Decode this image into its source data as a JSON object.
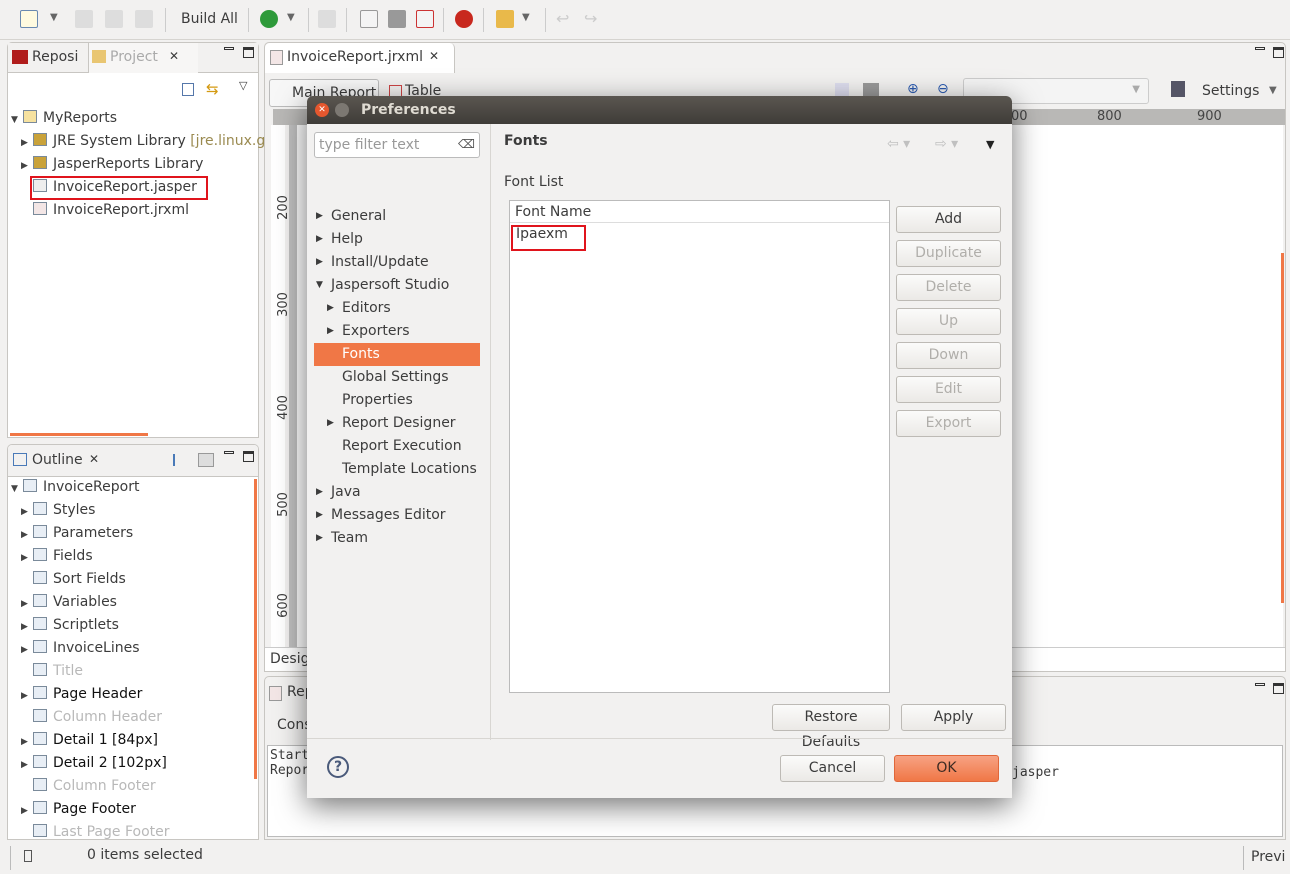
{
  "toolbar": {
    "build_all": "Build All"
  },
  "left_panel": {
    "tabs": [
      {
        "label": "Reposi"
      },
      {
        "label": "Project"
      }
    ],
    "tree": [
      {
        "label": "MyReports"
      },
      {
        "label": "JRE System Library",
        "suffix": "[jre.linux.gt"
      },
      {
        "label": "JasperReports Library"
      },
      {
        "label": "InvoiceReport.jasper"
      },
      {
        "label": "InvoiceReport.jrxml"
      }
    ]
  },
  "outline": {
    "title": "Outline",
    "items": [
      {
        "label": "InvoiceReport"
      },
      {
        "label": "Styles"
      },
      {
        "label": "Parameters"
      },
      {
        "label": "Fields"
      },
      {
        "label": "Sort Fields"
      },
      {
        "label": "Variables"
      },
      {
        "label": "Scriptlets"
      },
      {
        "label": "InvoiceLines"
      },
      {
        "label": "Title"
      },
      {
        "label": "Page Header"
      },
      {
        "label": "Column Header"
      },
      {
        "label": "Detail 1 [84px]"
      },
      {
        "label": "Detail 2 [102px]"
      },
      {
        "label": "Column Footer"
      },
      {
        "label": "Page Footer"
      },
      {
        "label": "Last Page Footer"
      }
    ]
  },
  "editor": {
    "tab": "InvoiceReport.jrxml",
    "subtabs": [
      {
        "label": "Main Report"
      },
      {
        "label": "Table"
      }
    ],
    "settings": "Settings",
    "ruler_top": [
      "00",
      "800",
      "900"
    ],
    "ruler_left": [
      "200",
      "300",
      "400",
      "500",
      "600"
    ],
    "design_tab": "Desig"
  },
  "console": {
    "tab": "Rep",
    "subtab": "Cons",
    "lines": [
      "Start",
      "Repor"
    ],
    "right_text": "jasper"
  },
  "status": {
    "text": "0 items selected",
    "right": "Previ"
  },
  "dialog": {
    "title": "Preferences",
    "filter_placeholder": "type filter text",
    "nav": [
      {
        "label": "General",
        "level": 0,
        "arrow": "right"
      },
      {
        "label": "Help",
        "level": 0,
        "arrow": "right"
      },
      {
        "label": "Install/Update",
        "level": 0,
        "arrow": "right"
      },
      {
        "label": "Jaspersoft Studio",
        "level": 0,
        "arrow": "down"
      },
      {
        "label": "Editors",
        "level": 1,
        "arrow": "right"
      },
      {
        "label": "Exporters",
        "level": 1,
        "arrow": "right"
      },
      {
        "label": "Fonts",
        "level": 1,
        "selected": true
      },
      {
        "label": "Global Settings",
        "level": 1
      },
      {
        "label": "Properties",
        "level": 1
      },
      {
        "label": "Report Designer",
        "level": 1,
        "arrow": "right"
      },
      {
        "label": "Report Execution",
        "level": 1
      },
      {
        "label": "Template Locations",
        "level": 1
      },
      {
        "label": "Java",
        "level": 0,
        "arrow": "right"
      },
      {
        "label": "Messages Editor",
        "level": 0,
        "arrow": "right"
      },
      {
        "label": "Team",
        "level": 0,
        "arrow": "right"
      }
    ],
    "page_title": "Fonts",
    "font_list_label": "Font List",
    "column_header": "Font Name",
    "fonts": [
      "Ipaexm"
    ],
    "side_buttons": [
      {
        "label": "Add",
        "enabled": true
      },
      {
        "label": "Duplicate",
        "enabled": false
      },
      {
        "label": "Delete",
        "enabled": false
      },
      {
        "label": "Up",
        "enabled": false
      },
      {
        "label": "Down",
        "enabled": false
      },
      {
        "label": "Edit",
        "enabled": false
      },
      {
        "label": "Export",
        "enabled": false
      }
    ],
    "restore_defaults": "Restore Defaults",
    "apply": "Apply",
    "cancel": "Cancel",
    "ok": "OK",
    "accent": "#f07746"
  }
}
